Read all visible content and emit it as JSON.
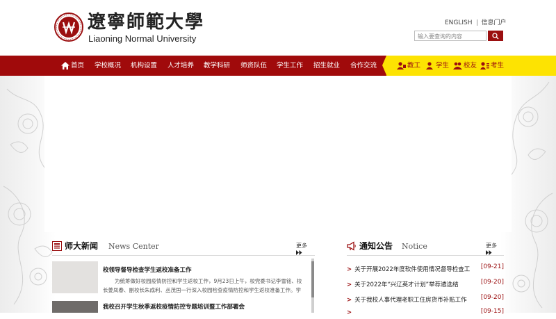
{
  "header": {
    "logo_cn": "遼寧師範大學",
    "logo_en": "Liaoning Normal University",
    "english_link": "ENGLISH",
    "portal_link": "信息门户",
    "search_placeholder": "输入要查询的内容"
  },
  "nav": {
    "items": [
      "首页",
      "学校概况",
      "机构设置",
      "人才培养",
      "教学科研",
      "师资队伍",
      "学生工作",
      "招生就业",
      "合作交流"
    ],
    "audience": [
      "教工",
      "学生",
      "校友",
      "考生"
    ]
  },
  "news": {
    "title": "师大新闻",
    "subtitle": "News Center",
    "more": "更多",
    "items": [
      {
        "title": "校领导督导检查学生返校准备工作",
        "summary": "为统筹做好校园疫情防控和学生返校工作，9月23日上午，校党委书记李雪铭、校长姜凤春、副校长朱成利、丛茂国一行深入校园检查疫情防控和学生返校准备工作。学"
      },
      {
        "title": "我校召开学生秋季返校疫情防控专题培训暨工作部署会",
        "summary": ""
      }
    ]
  },
  "notice": {
    "title": "通知公告",
    "subtitle": "Notice",
    "more": "更多",
    "items": [
      {
        "text": "关于开展2022年度软件使用情况督导检查工",
        "date": "[09-21]"
      },
      {
        "text": "关于2022年“兴辽英才计划”举荐遴选结",
        "date": "[09-20]"
      },
      {
        "text": "关于我校人事代理老职工住房货币补贴工作",
        "date": "[09-20]"
      },
      {
        "text": "",
        "date": "[09-15]"
      }
    ]
  },
  "colors": {
    "brand_red": "#a00a0b",
    "nav_yellow": "#fde302"
  }
}
